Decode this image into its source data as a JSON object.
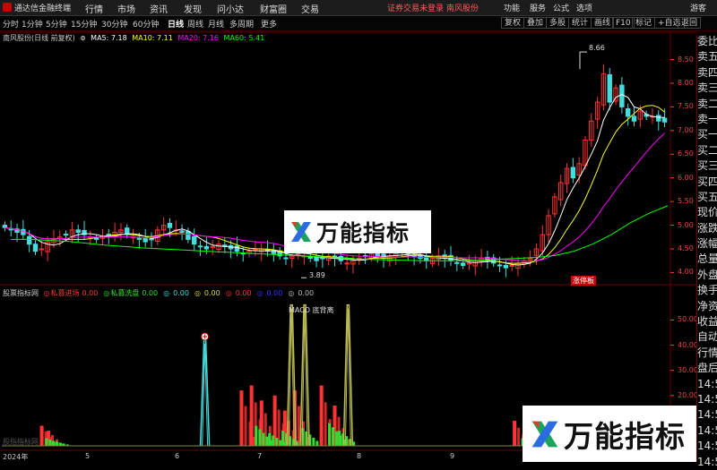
{
  "titlebar": {
    "app_title": "通达信金融终端",
    "menus": [
      "行情",
      "市场",
      "资讯",
      "发现",
      "问小达",
      "财富圈",
      "交易"
    ],
    "notice": "证券交易未登录",
    "stock_tag": "南风股份",
    "right_items": [
      "功能",
      "服务",
      "公式",
      "选项"
    ],
    "user": "游客"
  },
  "toolbar": {
    "periods": [
      "分时",
      "1分钟",
      "5分钟",
      "15分钟",
      "30分钟",
      "60分钟",
      "日线",
      "周线",
      "月线",
      "多周期",
      "更多"
    ],
    "active_period": "日线",
    "functions": [
      "复权",
      "叠加",
      "多股",
      "统计",
      "画线",
      "F10",
      "标记",
      "+自选",
      "返回"
    ]
  },
  "legend": {
    "stock_name": "南风股份(日线 前复权)",
    "ma5": "MA5: 7.18",
    "ma10": "MA10: 7.11",
    "ma20": "MA20: 7.16",
    "ma60": "MA60: 5.41"
  },
  "indicator_legend": {
    "name": "股票指标网",
    "items": [
      {
        "label": "私募进场",
        "value": "0.00",
        "color": "#ff3333"
      },
      {
        "label": "私募洗盘",
        "value": "0.00",
        "color": "#33dd33"
      },
      {
        "label": "",
        "value": "0.00",
        "color": "#44dddd"
      },
      {
        "label": "",
        "value": "0.00",
        "color": "#dddd33"
      },
      {
        "label": "",
        "value": "0.00",
        "color": "#ff3333"
      },
      {
        "label": "",
        "value": "0.00",
        "color": "#3333ff"
      },
      {
        "label": "",
        "value": "0.00",
        "color": "#bbbbbb"
      }
    ]
  },
  "orderbook_labels": [
    "委比",
    "卖五",
    "卖四",
    "卖三",
    "卖二",
    "卖一",
    "买一",
    "买二",
    "买三",
    "买四",
    "买五",
    "现价",
    "涨跌",
    "涨幅",
    "总量",
    "外盘",
    "换手",
    "净资",
    "收益",
    "自动",
    "行情",
    "盘后",
    "14:5",
    "14:5",
    "14:5",
    "14:5",
    "14:5",
    "14:5"
  ],
  "annotations": {
    "high": "8.66",
    "low": "3.89",
    "badge": "涨停板",
    "macd_label": "MACD 底背离",
    "watermark": "万能指标",
    "indicator_subtitle": "股指指标网"
  },
  "colors": {
    "up": "#ff3333",
    "down": "#44dddd",
    "ma5": "#ffffff",
    "ma10": "#ffff00",
    "ma20": "#ff00ff",
    "ma60": "#00ff00"
  },
  "chart_data": [
    {
      "type": "candlestick",
      "y_ticks": [
        "8.50",
        "8.00",
        "7.50",
        "7.00",
        "6.50",
        "6.00",
        "5.50",
        "5.00",
        "4.50",
        "4.00"
      ],
      "ylim": [
        3.8,
        8.85
      ],
      "x_ticks": [
        "2024年",
        "5",
        "6",
        "7",
        "8",
        "9"
      ],
      "high": 8.66,
      "low": 3.89,
      "close_series": [
        4.95,
        4.9,
        4.85,
        4.8,
        4.6,
        4.45,
        4.5,
        4.65,
        4.7,
        4.75,
        4.8,
        4.9,
        4.85,
        4.8,
        4.75,
        4.7,
        4.75,
        4.8,
        4.85,
        4.9,
        4.8,
        4.75,
        4.7,
        4.65,
        4.7,
        4.9,
        5.0,
        4.95,
        4.9,
        4.85,
        4.7,
        4.6,
        4.55,
        4.5,
        4.55,
        4.6,
        4.55,
        4.5,
        4.45,
        4.4,
        4.45,
        4.5,
        4.5,
        4.45,
        4.4,
        4.35,
        4.3,
        4.35,
        4.4,
        4.35,
        4.3,
        4.25,
        4.3,
        4.35,
        4.3,
        4.25,
        4.2,
        4.25,
        4.3,
        4.35,
        4.4,
        4.35,
        4.3,
        4.35,
        4.4,
        4.45,
        4.4,
        4.35,
        4.3,
        4.25,
        4.3,
        4.35,
        4.3,
        4.25,
        4.2,
        4.15,
        4.2,
        4.25,
        4.3,
        4.25,
        4.2,
        4.15,
        4.1,
        4.15,
        4.2,
        4.25,
        4.3,
        4.5,
        4.8,
        5.2,
        5.6,
        5.9,
        6.2,
        6.0,
        6.3,
        6.8,
        7.2,
        7.6,
        8.2,
        7.6,
        7.9,
        7.5,
        7.3,
        7.2,
        7.4,
        7.3,
        7.3,
        7.2,
        7.18
      ],
      "ma60_series": [
        4.7,
        4.7,
        4.68,
        4.66,
        4.62,
        4.58,
        4.55,
        4.52,
        4.5,
        4.48,
        4.46,
        4.44,
        4.42,
        4.4,
        4.38,
        4.36,
        4.34,
        4.32,
        4.3,
        4.28,
        4.27,
        4.26,
        4.25,
        4.25,
        4.25,
        4.26,
        4.28,
        4.3,
        4.32,
        4.36,
        4.45,
        4.6,
        4.8,
        5.05,
        5.25,
        5.41
      ]
    },
    {
      "type": "bar",
      "y_ticks": [
        "50.00",
        "40.00",
        "30.00",
        "20.00",
        "10.00"
      ],
      "ylim": [
        0,
        58
      ],
      "series": [
        {
          "name": "私募进场",
          "color": "#ff3333"
        },
        {
          "name": "私募洗盘",
          "color": "#33dd33"
        }
      ],
      "spikes": [
        {
          "at": 0.305,
          "value": 42,
          "color": "#44dddd"
        },
        {
          "at": 0.435,
          "value": 56,
          "color": "#bbbb55"
        },
        {
          "at": 0.455,
          "value": 56,
          "color": "#bbbb55"
        },
        {
          "at": 0.52,
          "value": 56,
          "color": "#bbbb55"
        }
      ],
      "red_bars": [
        {
          "at": 0.06,
          "value": 8
        },
        {
          "at": 0.07,
          "value": 6
        },
        {
          "at": 0.36,
          "value": 22
        },
        {
          "at": 0.375,
          "value": 24
        },
        {
          "at": 0.39,
          "value": 18
        },
        {
          "at": 0.41,
          "value": 20
        },
        {
          "at": 0.425,
          "value": 14
        },
        {
          "at": 0.44,
          "value": 22
        },
        {
          "at": 0.48,
          "value": 24
        },
        {
          "at": 0.5,
          "value": 16
        },
        {
          "at": 0.77,
          "value": 10
        }
      ],
      "green_bars": [
        {
          "at": 0.065,
          "value": 3
        },
        {
          "at": 0.075,
          "value": 2
        },
        {
          "at": 0.38,
          "value": 8
        },
        {
          "at": 0.4,
          "value": 5
        },
        {
          "at": 0.42,
          "value": 6
        },
        {
          "at": 0.45,
          "value": 7
        },
        {
          "at": 0.49,
          "value": 9
        },
        {
          "at": 0.505,
          "value": 6
        },
        {
          "at": 0.78,
          "value": 3
        }
      ]
    }
  ]
}
